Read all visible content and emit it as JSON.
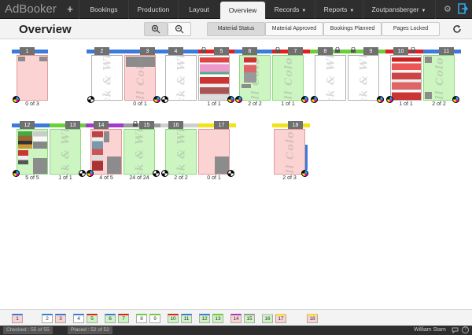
{
  "app": {
    "brand": "AdBooker",
    "plus_icon": "+",
    "nav": [
      {
        "label": "Bookings",
        "active": false
      },
      {
        "label": "Production",
        "active": false
      },
      {
        "label": "Layout",
        "active": false
      },
      {
        "label": "Overview",
        "active": true
      },
      {
        "label": "Records",
        "dropdown": true
      },
      {
        "label": "Reports",
        "dropdown": true
      },
      {
        "label": "Zoutpansberger",
        "dropdown": true
      }
    ],
    "gear_icon": "gear-icon",
    "logout_icon": "logout-icon"
  },
  "header": {
    "title": "Overview",
    "zoom_in_icon": "zoom-in-icon",
    "zoom_out_icon": "zoom-out-icon",
    "filters": [
      {
        "label": "Material Status",
        "active": true
      },
      {
        "label": "Material Approved",
        "active": false
      },
      {
        "label": "Bookings Planned",
        "active": false
      },
      {
        "label": "Pages Locked",
        "active": false
      }
    ],
    "refresh_icon": "refresh-icon"
  },
  "pages": [
    {
      "num": "1",
      "status": "red",
      "label": "Full Colour",
      "count": "0 of 3",
      "section": "#3a7bdc"
    },
    {
      "num": "2",
      "status": "white",
      "label": "Black & White",
      "count": "",
      "section": "#3a7bdc"
    },
    {
      "num": "3",
      "status": "red",
      "label": "Full Colour",
      "count": "0 of 1",
      "section": "#3a7bdc"
    },
    {
      "num": "4",
      "status": "white",
      "label": "Black & White",
      "count": "",
      "section": "#3a7bdc"
    },
    {
      "num": "5",
      "status": "white",
      "label": "",
      "count": "1 of 1",
      "section": "#e02020"
    },
    {
      "num": "6",
      "status": "green",
      "label": "Full Colour",
      "count": "2 of 2",
      "section": "#3a7bdc"
    },
    {
      "num": "7",
      "status": "green",
      "label": "Full Colour",
      "count": "1 of 1",
      "section": "#e02020"
    },
    {
      "num": "8",
      "status": "white",
      "label": "Black & White",
      "count": "",
      "section": "#6ccf3a"
    },
    {
      "num": "9",
      "status": "white",
      "label": "Black & White",
      "count": "",
      "section": "#6ccf3a"
    },
    {
      "num": "10",
      "status": "white",
      "label": "",
      "count": "1 of 1",
      "section": "#e02020"
    },
    {
      "num": "11",
      "status": "green",
      "label": "Full Colour",
      "count": "2 of 2",
      "section": "#3a7bdc"
    },
    {
      "num": "12",
      "status": "green",
      "label": "",
      "count": "5 of 5",
      "section": "#3a7bdc"
    },
    {
      "num": "13",
      "status": "green",
      "label": "Black & White",
      "count": "1 of 1",
      "section": "#6ccf3a"
    },
    {
      "num": "14",
      "status": "red",
      "label": "",
      "count": "4 of 5",
      "section": "#a23cc8"
    },
    {
      "num": "15",
      "status": "green",
      "label": "Black & White",
      "count": "24 of 24",
      "section": "#9a9a9a"
    },
    {
      "num": "16",
      "status": "green",
      "label": "Black & White",
      "count": "2 of 2",
      "section": "#cfcfcf"
    },
    {
      "num": "17",
      "status": "red",
      "label": "",
      "count": "0 of 1",
      "section": "#f2e21a"
    },
    {
      "num": "18",
      "status": "red",
      "label": "Full Colour",
      "count": "2 of 3",
      "section": "#f2e21a"
    }
  ],
  "strip": [
    "1",
    "2",
    "3",
    "4",
    "5",
    "6",
    "7",
    "8",
    "9",
    "10",
    "11",
    "12",
    "13",
    "14",
    "15",
    "16",
    "17",
    "18"
  ],
  "status": {
    "checked": "Checked : 55 of 55",
    "placed": "Placed : 52 of 52",
    "user": "William Stam",
    "chat_icon": "chat-icon",
    "help_icon": "help-icon"
  }
}
